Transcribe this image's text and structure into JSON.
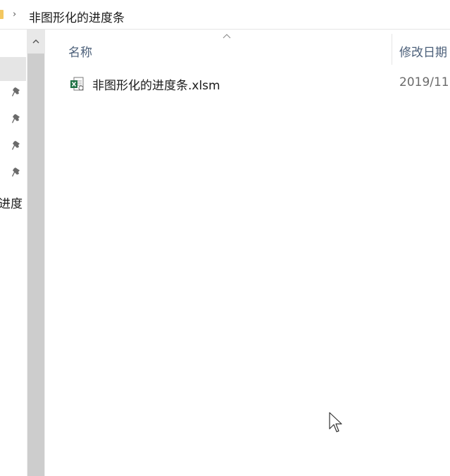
{
  "breadcrumb": {
    "separator": "›",
    "current": "非图形化的进度条"
  },
  "nav": {
    "partial_item_label": "进度"
  },
  "list": {
    "columns": {
      "name": "名称",
      "date_modified": "修改日期"
    },
    "files": [
      {
        "name": "非图形化的进度条.xlsm",
        "date": "2019/11"
      }
    ]
  },
  "colors": {
    "header_text": "#4c607a",
    "excel_green": "#217346",
    "folder_yellow": "#f3c760"
  }
}
